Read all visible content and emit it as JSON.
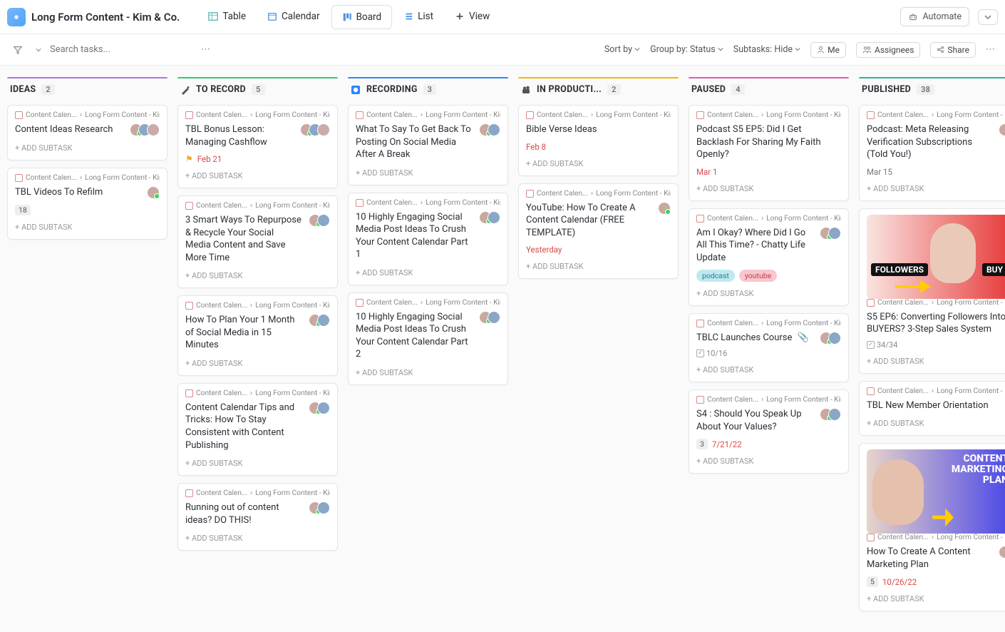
{
  "header": {
    "title": "Long Form Content - Kim & Co.",
    "tabs": [
      "Table",
      "Calendar",
      "Board",
      "List",
      "View"
    ],
    "active_tab": "Board",
    "automate": "Automate"
  },
  "toolbar": {
    "search_placeholder": "Search tasks...",
    "sort": "Sort by",
    "group_label": "Group by:",
    "group_value": "Status",
    "subtasks_label": "Subtasks:",
    "subtasks_value": "Hide",
    "me": "Me",
    "assignees": "Assignees",
    "share": "Share"
  },
  "ui": {
    "add_subtask": "+ ADD SUBTASK",
    "bc1": "Content Calen...",
    "bc2": "Long Form Content - Kim & ..."
  },
  "columns": [
    {
      "id": "ideas",
      "label": "IDEAS",
      "count": "2",
      "color": "#b074e6"
    },
    {
      "id": "torecord",
      "label": "TO RECORD",
      "count": "5",
      "color": "#2ecc71"
    },
    {
      "id": "recording",
      "label": "RECORDING",
      "count": "3",
      "color": "#2a86ff"
    },
    {
      "id": "inproduction",
      "label": "IN PRODUCTI...",
      "count": "2",
      "color": "#f5b400"
    },
    {
      "id": "paused",
      "label": "PAUSED",
      "count": "4",
      "color": "#e65aa8"
    },
    {
      "id": "published",
      "label": "PUBLISHED",
      "count": "38",
      "color": "#1abc9c"
    }
  ],
  "cards": {
    "ideas": [
      {
        "title": "Content Ideas Research",
        "avatars": 3
      },
      {
        "title": "TBL Videos To Refilm",
        "avatars": 1,
        "badge": "18"
      }
    ],
    "torecord": [
      {
        "title": "TBL Bonus Lesson: Managing Cashflow",
        "avatars": 3,
        "flag": true,
        "date": "Feb 21",
        "date_red": true
      },
      {
        "title": "3 Smart Ways To Repurpose & Recycle Your Social Media Content and Save More Time",
        "avatars": 2
      },
      {
        "title": "How To Plan Your 1 Month of Social Media in 15 Minutes",
        "avatars": 2
      },
      {
        "title": "Content Calendar Tips and Tricks: How To Stay Consistent with Content Publishing",
        "avatars": 2
      },
      {
        "title": "Running out of content ideas? DO THIS!",
        "avatars": 2
      }
    ],
    "recording": [
      {
        "title": "What To Say To Get Back To Posting On Social Media After A Break",
        "avatars": 2
      },
      {
        "title": "10 Highly Engaging Social Media Post Ideas To Crush Your Content Calendar Part 1",
        "avatars": 2
      },
      {
        "title": "10 Highly Engaging Social Media Post Ideas To Crush Your Content Calendar Part 2",
        "avatars": 2
      }
    ],
    "inproduction": [
      {
        "title": "Bible Verse Ideas",
        "avatars": 0,
        "date": "Feb 8",
        "date_red": true
      },
      {
        "title": "YouTube: How To Create A Content Calendar (FREE TEMPLATE)",
        "avatars": 1,
        "date": "Yesterday",
        "date_red": true
      }
    ],
    "paused": [
      {
        "title": "Podcast S5 EP5: Did I Get Backlash For Sharing My Faith Openly?",
        "avatars": 0,
        "date": "Mar 1",
        "date_red": true
      },
      {
        "title": "Am I Okay? Where Did I Go All This Time? - Chatty Life Update",
        "avatars": 2,
        "tags": [
          "podcast",
          "youtube"
        ]
      },
      {
        "title": "TBLC Launches Course",
        "avatars": 2,
        "clip": true,
        "check": "10/16"
      },
      {
        "title": "S4 : Should You Speak Up About Your Values?",
        "avatars": 2,
        "badge": "3",
        "date": "7/21/22",
        "date_red": true
      }
    ],
    "published": [
      {
        "title": "Podcast: Meta Releasing Verification Subscriptions (Told You!)",
        "avatars": 1,
        "date": "Mar 15",
        "date_red": false
      },
      {
        "thumb": "t1",
        "thumb_labels": {
          "followers": "FOLLOWERS",
          "buy": "BUY"
        },
        "title": "S5 EP6: Converting Followers Into BUYERS? 3-Step Sales System",
        "avatars": 0,
        "check": "34/34"
      },
      {
        "title": "TBL New Member Orientation",
        "avatars": 0
      },
      {
        "thumb": "t2",
        "thumb_labels": {
          "big": "CONTENT\nMARKETING\nPLAN"
        },
        "title": "How To Create A Content Marketing Plan",
        "avatars": 1,
        "badge": "5",
        "date": "10/26/22",
        "date_red": true
      }
    ]
  }
}
